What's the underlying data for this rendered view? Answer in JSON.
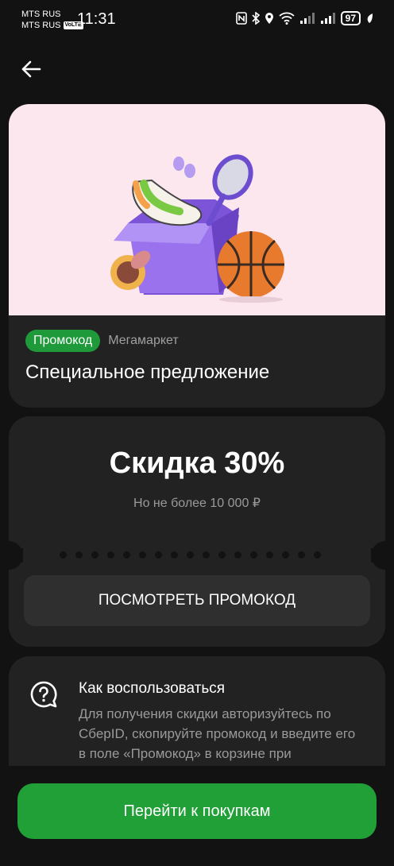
{
  "status_bar": {
    "carrier_1": "MTS RUS",
    "carrier_2": "MTS RUS",
    "volte": "VoLTE",
    "time": "11:31",
    "battery": "97"
  },
  "offer": {
    "badge": "Промокод",
    "brand": "Мегамаркет",
    "title": "Специальное предложение",
    "hero_background": "#fde7ee"
  },
  "discount": {
    "headline": "Скидка 30%",
    "limit": "Но не более 10 000 ₽",
    "reveal_button": "ПОСМОТРЕТЬ ПРОМОКОД"
  },
  "howto": {
    "title": "Как воспользоваться",
    "text": "Для получения скидки авторизуйтесь по СберID, скопируйте промокод и введите его в поле «Промокод» в корзине при оформлении заказа"
  },
  "cta": {
    "label": "Перейти к покупкам"
  },
  "colors": {
    "background": "#121212",
    "card": "#222222",
    "accent_green": "#21a038"
  }
}
